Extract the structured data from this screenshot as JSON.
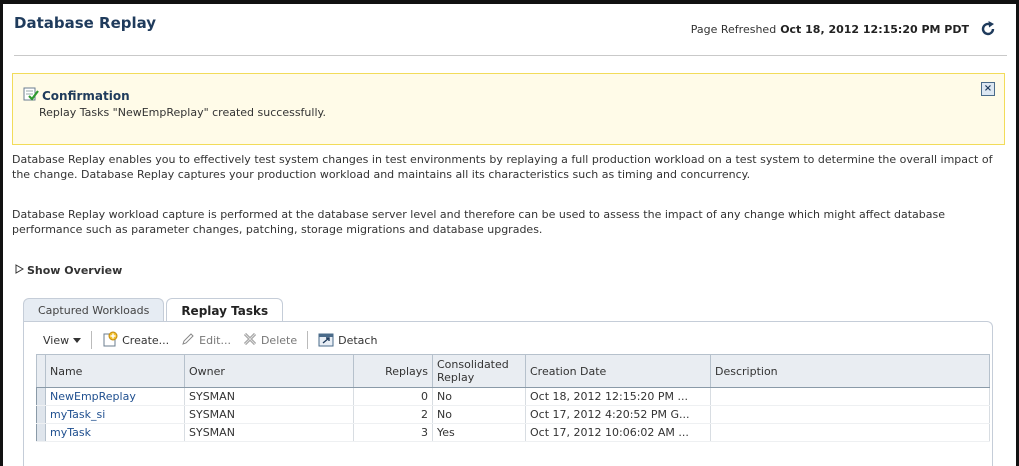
{
  "page": {
    "title": "Database Replay",
    "refresh_label": "Page Refreshed",
    "refresh_time": "Oct 18, 2012 12:15:20 PM PDT"
  },
  "confirmation": {
    "title": "Confirmation",
    "message": "Replay Tasks \"NewEmpReplay\" created successfully.",
    "close_label": "×"
  },
  "description": {
    "para1": "Database Replay enables you to effectively test system changes in test environments by replaying a full production workload on a test system to determine the overall impact of the change. Database Replay captures your production workload and maintains all its characteristics such as timing and concurrency.",
    "para2": "Database Replay workload capture is performed at the database server level and therefore can be used to assess the impact of any change which might affect database performance such as parameter changes, patching, storage migrations and database upgrades."
  },
  "overview": {
    "label": "Show Overview"
  },
  "tabs": [
    {
      "label": "Captured Workloads",
      "active": false
    },
    {
      "label": "Replay Tasks",
      "active": true
    }
  ],
  "toolbar": {
    "view": "View",
    "create": "Create...",
    "edit": "Edit...",
    "delete": "Delete",
    "detach": "Detach"
  },
  "table": {
    "columns": [
      "Name",
      "Owner",
      "Replays",
      "Consolidated Replay",
      "Creation Date",
      "Description"
    ],
    "rows": [
      {
        "name": "NewEmpReplay",
        "owner": "SYSMAN",
        "replays": "0",
        "consolidated": "No",
        "created": "Oct 18, 2012 12:15:20 PM ...",
        "description": ""
      },
      {
        "name": "myTask_si",
        "owner": "SYSMAN",
        "replays": "2",
        "consolidated": "No",
        "created": "Oct 17, 2012 4:20:52 PM G...",
        "description": ""
      },
      {
        "name": "myTask",
        "owner": "SYSMAN",
        "replays": "3",
        "consolidated": "Yes",
        "created": "Oct 17, 2012 10:06:02 AM ...",
        "description": ""
      }
    ]
  }
}
